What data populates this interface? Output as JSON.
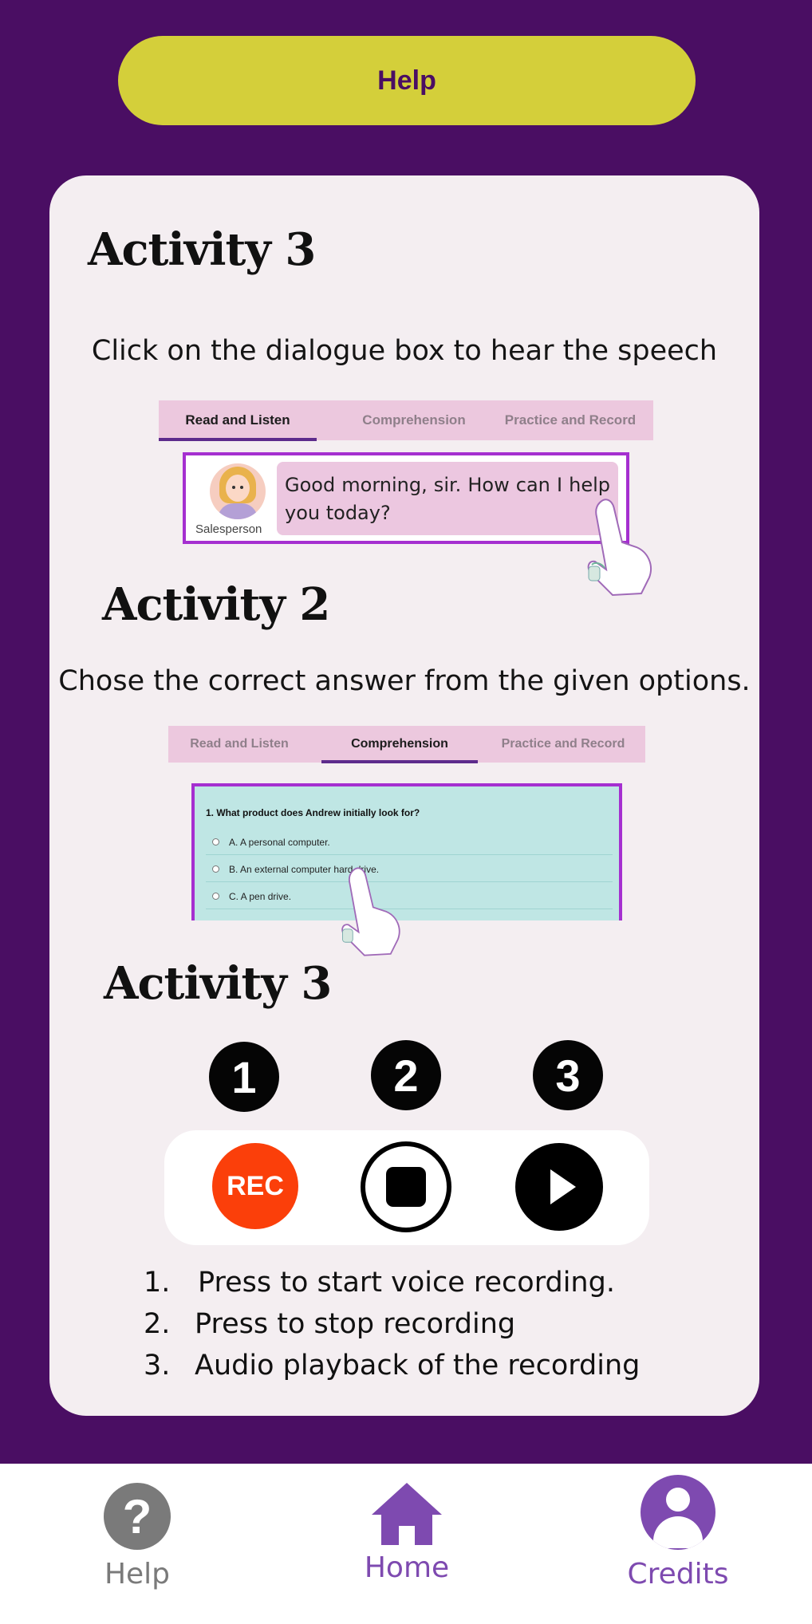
{
  "top_button": {
    "label": "Help"
  },
  "colors": {
    "background": "#4a0e63",
    "help_button": "#d4cf3a",
    "card": "#f4eef1",
    "accent_purple": "#7e4ab0",
    "rec_red": "#fb3f0a"
  },
  "activity_a": {
    "title": "Activity 3",
    "instruction": "Click on the  dialogue box to hear the speech",
    "tabs": [
      "Read and Listen",
      "Comprehension",
      "Practice and Record"
    ],
    "active_tab": "Read and Listen",
    "speaker_label": "Salesperson",
    "dialogue": "Good morning, sir. How can I help you today?"
  },
  "activity_b": {
    "title": "Activity 2",
    "instruction": "Chose the correct answer from the given options.",
    "tabs": [
      "Read and Listen",
      "Comprehension",
      "Practice and Record"
    ],
    "active_tab": "Comprehension",
    "question": "1. What product does Andrew initially look for?",
    "options": [
      "A. A personal computer.",
      "B. An external computer hard drive.",
      "C. A pen drive."
    ]
  },
  "activity_c": {
    "title": "Activity 3",
    "numbers": [
      "1",
      "2",
      "3"
    ],
    "rec_label": "REC",
    "steps": [
      {
        "n": "1.",
        "text": "Press to start voice recording."
      },
      {
        "n": "2.",
        "text": "Press to stop recording"
      },
      {
        "n": "3.",
        "text": "Audio playback of the recording"
      }
    ]
  },
  "bottom_nav": {
    "help": "Help",
    "home": "Home",
    "credits": "Credits",
    "help_color": "#7a7a7a",
    "active_color": "#7e4ab0"
  }
}
